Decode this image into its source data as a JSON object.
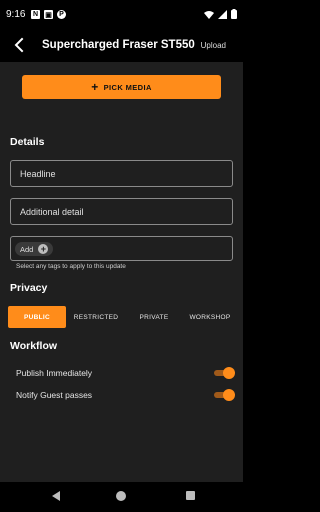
{
  "status": {
    "time": "9:16",
    "icons": [
      "notification-n-icon",
      "notification-box-icon",
      "notification-p-icon",
      "wifi-icon",
      "signal-icon",
      "battery-icon"
    ]
  },
  "appbar": {
    "title": "Supercharged Fraser ST550",
    "action": "Upload"
  },
  "pick_media": {
    "icon": "plus",
    "label": "PICK MEDIA"
  },
  "details": {
    "title": "Details",
    "headline_placeholder": "Headline",
    "detail_placeholder": "Additional detail",
    "tags": {
      "add_label": "Add",
      "helper": "Select any tags to apply to this update"
    }
  },
  "privacy": {
    "title": "Privacy",
    "options": [
      "PUBLIC",
      "RESTRICTED",
      "PRIVATE",
      "WORKSHOP"
    ],
    "selected": "PUBLIC"
  },
  "workflow": {
    "title": "Workflow",
    "items": [
      {
        "label": "Publish Immediately",
        "on": true
      },
      {
        "label": "Notify Guest passes",
        "on": true
      }
    ]
  },
  "colors": {
    "accent": "#ff8c1a",
    "surface": "#1f1f1f",
    "bar": "#000000"
  }
}
